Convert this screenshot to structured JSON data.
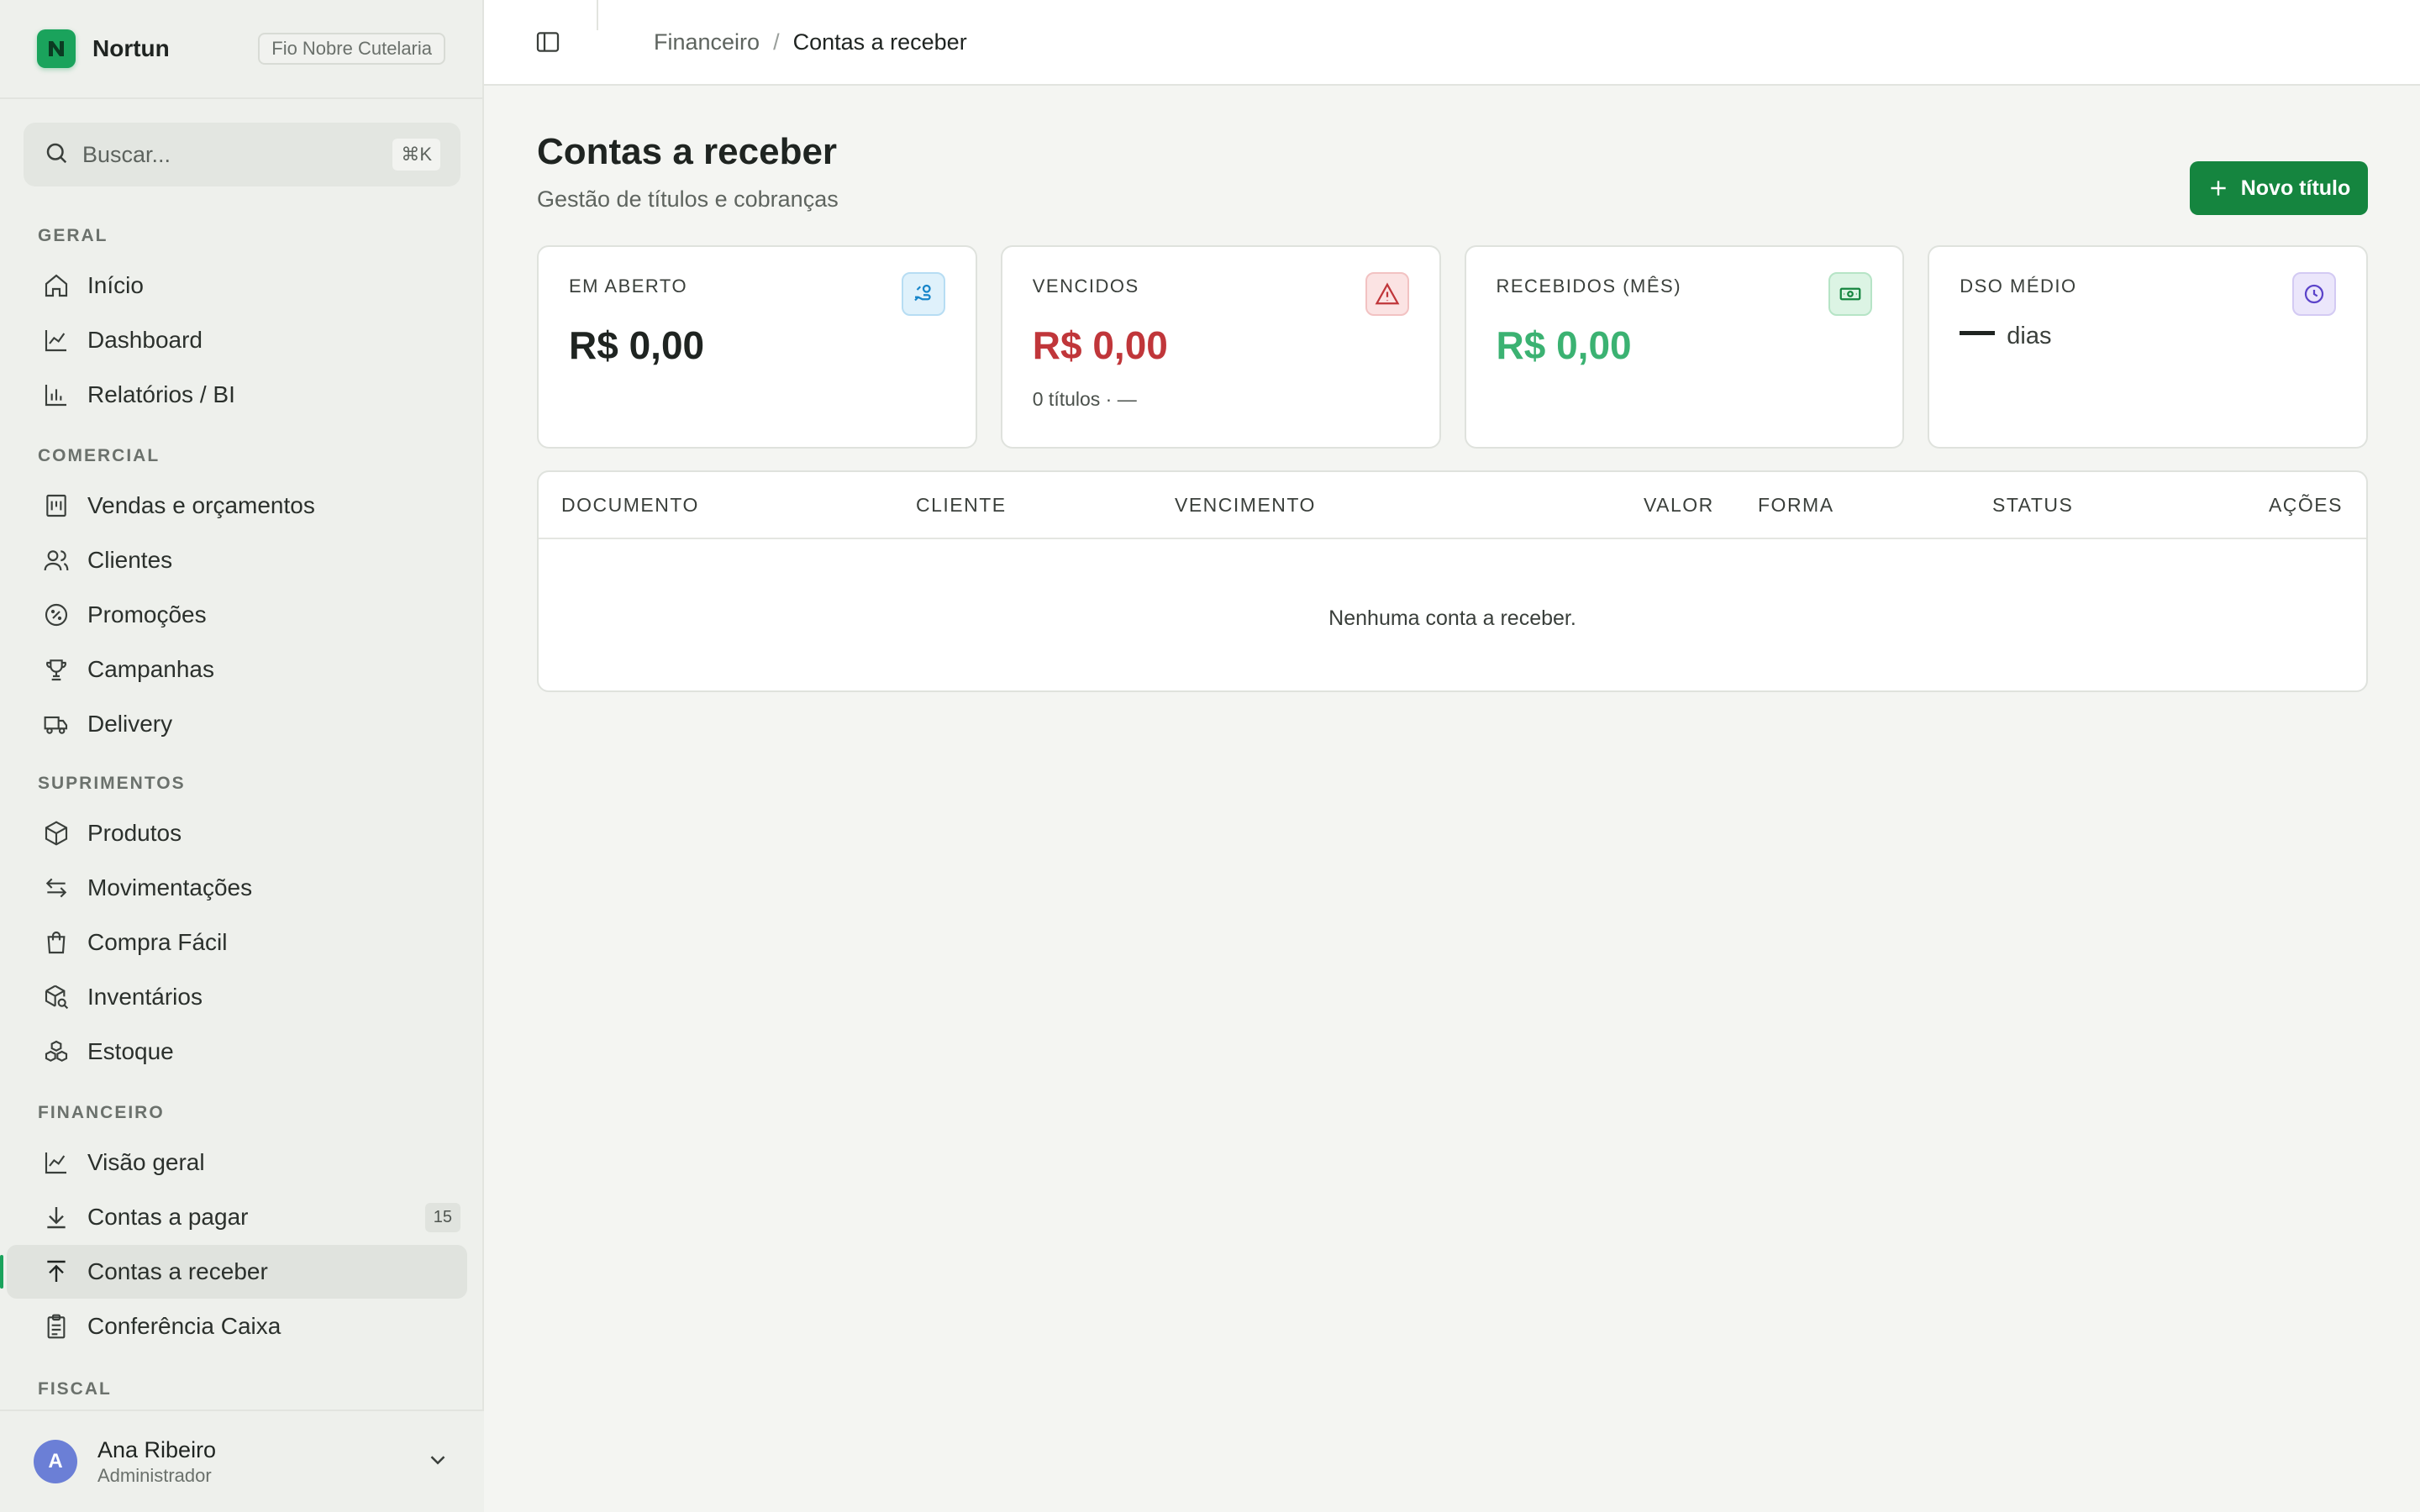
{
  "brand": {
    "name": "Nortun",
    "org": "Fio Nobre Cutelaria"
  },
  "search": {
    "placeholder": "Buscar...",
    "shortcut": "⌘K"
  },
  "nav": {
    "sections": [
      {
        "title": "GERAL",
        "items": [
          {
            "label": "Início",
            "icon": "home-icon"
          },
          {
            "label": "Dashboard",
            "icon": "line-chart-icon"
          },
          {
            "label": "Relatórios / BI",
            "icon": "bar-chart-icon"
          }
        ]
      },
      {
        "title": "COMERCIAL",
        "items": [
          {
            "label": "Vendas e orçamentos",
            "icon": "receipt-icon"
          },
          {
            "label": "Clientes",
            "icon": "users-icon"
          },
          {
            "label": "Promoções",
            "icon": "percent-badge-icon"
          },
          {
            "label": "Campanhas",
            "icon": "trophy-icon"
          },
          {
            "label": "Delivery",
            "icon": "truck-icon"
          }
        ]
      },
      {
        "title": "SUPRIMENTOS",
        "items": [
          {
            "label": "Produtos",
            "icon": "box-icon"
          },
          {
            "label": "Movimentações",
            "icon": "arrows-left-right-icon"
          },
          {
            "label": "Compra Fácil",
            "icon": "shopping-bag-icon"
          },
          {
            "label": "Inventários",
            "icon": "package-search-icon"
          },
          {
            "label": "Estoque",
            "icon": "boxes-icon"
          }
        ]
      },
      {
        "title": "FINANCEIRO",
        "items": [
          {
            "label": "Visão geral",
            "icon": "line-chart-icon"
          },
          {
            "label": "Contas a pagar",
            "icon": "download-icon",
            "count": "15"
          },
          {
            "label": "Contas a receber",
            "icon": "upload-icon",
            "active": true
          },
          {
            "label": "Conferência Caixa",
            "icon": "clipboard-icon"
          }
        ]
      },
      {
        "title": "FISCAL",
        "items": []
      }
    ]
  },
  "user": {
    "initial": "A",
    "name": "Ana Ribeiro",
    "role": "Administrador"
  },
  "breadcrumb": {
    "parent": "Financeiro",
    "separator": "/",
    "current": "Contas a receber"
  },
  "page": {
    "title": "Contas a receber",
    "subtitle": "Gestão de títulos e cobranças",
    "new_button": "Novo título"
  },
  "cards": {
    "open": {
      "label": "EM ABERTO",
      "value": "R$ 0,00",
      "icon": "hand-coins-icon",
      "color": "#1f2421"
    },
    "overdue": {
      "label": "VENCIDOS",
      "value": "R$ 0,00",
      "note": "0 títulos · —",
      "icon": "alert-triangle-icon",
      "color": "#c0363a"
    },
    "received": {
      "label": "RECEBIDOS (MÊS)",
      "value": "R$ 0,00",
      "icon": "banknote-icon",
      "color": "#3bb272"
    },
    "dso": {
      "label": "DSO MÉDIO",
      "unit": "dias",
      "icon": "clock-icon"
    }
  },
  "table": {
    "columns": [
      "DOCUMENTO",
      "CLIENTE",
      "VENCIMENTO",
      "VALOR",
      "FORMA",
      "STATUS",
      "AÇÕES"
    ],
    "empty": "Nenhuma conta a receber."
  },
  "colors": {
    "accent": "#15853f",
    "brand": "#1aa35c",
    "danger": "#c0363a",
    "success": "#3bb272"
  }
}
